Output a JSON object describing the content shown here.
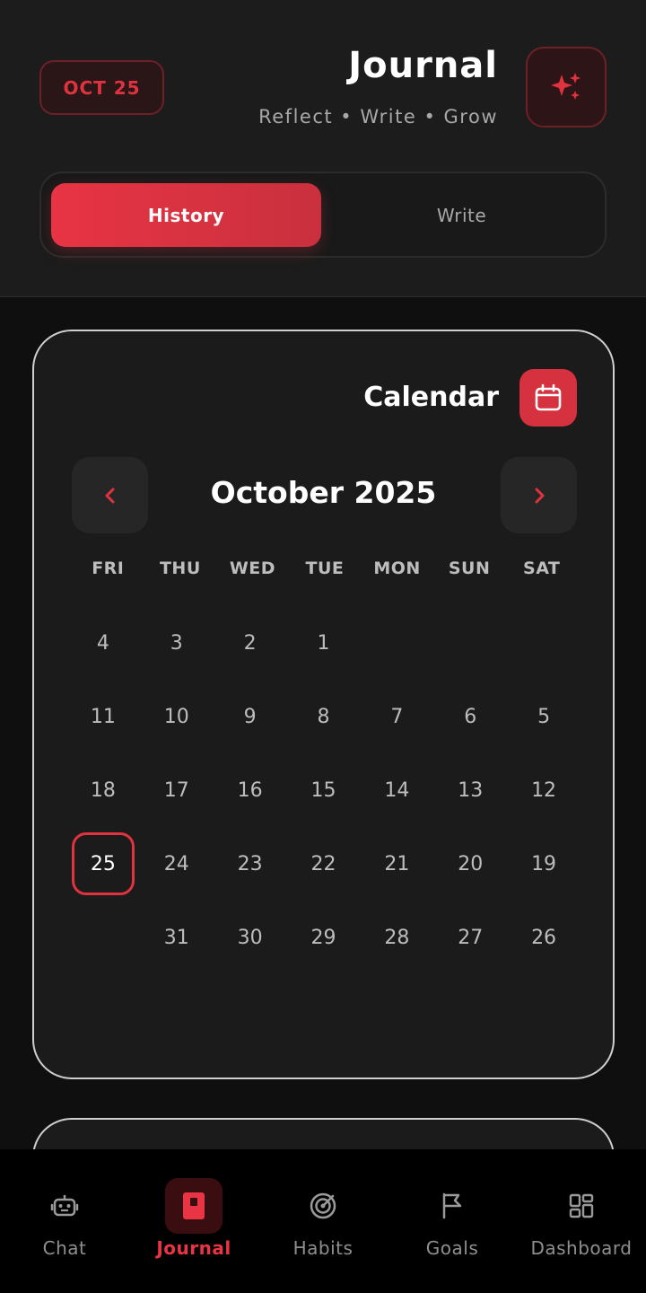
{
  "header": {
    "date_badge": "OCT 25",
    "title": "Journal",
    "subtitle": "Reflect • Write • Grow",
    "sparkle_icon": "sparkles-icon",
    "tabs": [
      {
        "label": "History",
        "active": true
      },
      {
        "label": "Write",
        "active": false
      }
    ]
  },
  "calendar": {
    "title": "Calendar",
    "icon": "calendar-icon",
    "month": "October 2025",
    "prev_icon": "chevron-left-icon",
    "next_icon": "chevron-right-icon",
    "weekdays": [
      "FRI",
      "THU",
      "WED",
      "TUE",
      "MON",
      "SUN",
      "SAT"
    ],
    "weeks": [
      [
        "4",
        "3",
        "2",
        "1",
        "",
        "",
        ""
      ],
      [
        "11",
        "10",
        "9",
        "8",
        "7",
        "6",
        "5"
      ],
      [
        "18",
        "17",
        "16",
        "15",
        "14",
        "13",
        "12"
      ],
      [
        "25",
        "24",
        "23",
        "22",
        "21",
        "20",
        "19"
      ],
      [
        "",
        "31",
        "30",
        "29",
        "28",
        "27",
        "26"
      ]
    ],
    "selected_day": "25"
  },
  "bottom_nav": {
    "items": [
      {
        "label": "Chat",
        "icon": "robot-icon",
        "active": false
      },
      {
        "label": "Journal",
        "icon": "book-icon",
        "active": true
      },
      {
        "label": "Habits",
        "icon": "target-icon",
        "active": false
      },
      {
        "label": "Goals",
        "icon": "flag-icon",
        "active": false
      },
      {
        "label": "Dashboard",
        "icon": "grid-icon",
        "active": false
      }
    ]
  },
  "colors": {
    "accent": "#e83444",
    "background": "#0f0f0f",
    "card": "#1b1b1b"
  }
}
